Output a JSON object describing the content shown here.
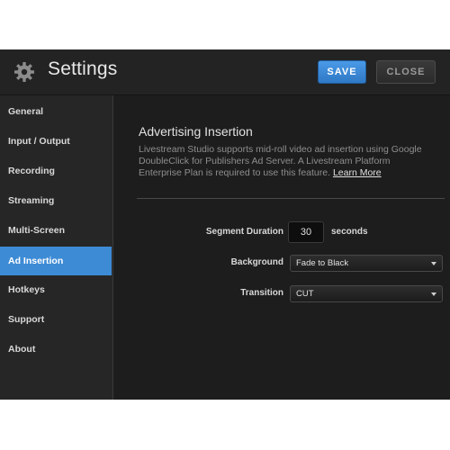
{
  "header": {
    "title": "Settings",
    "save_label": "SAVE",
    "close_label": "CLOSE"
  },
  "sidebar": {
    "items": [
      {
        "label": "General",
        "active": false
      },
      {
        "label": "Input / Output",
        "active": false
      },
      {
        "label": "Recording",
        "active": false
      },
      {
        "label": "Streaming",
        "active": false
      },
      {
        "label": "Multi-Screen",
        "active": false
      },
      {
        "label": "Ad Insertion",
        "active": true
      },
      {
        "label": "Hotkeys",
        "active": false
      },
      {
        "label": "Support",
        "active": false
      },
      {
        "label": "About",
        "active": false
      }
    ]
  },
  "main": {
    "section_title": "Advertising Insertion",
    "description": "Livestream Studio supports mid-roll video ad insertion using Google DoubleClick for Publishers Ad Server. A Livestream Platform Enterprise Plan is required to use this feature.",
    "learn_more": "Learn More",
    "segment_duration": {
      "label": "Segment Duration",
      "value": "30",
      "unit": "seconds"
    },
    "background": {
      "label": "Background",
      "selected": "Fade to Black"
    },
    "transition": {
      "label": "Transition",
      "selected": "CUT"
    }
  },
  "colors": {
    "accent": "#3d8bd5",
    "window_bg": "#202020",
    "content_bg": "#1d1d1d"
  },
  "icons": {
    "settings": "gear-icon",
    "dropdown": "chevron-down-icon"
  }
}
